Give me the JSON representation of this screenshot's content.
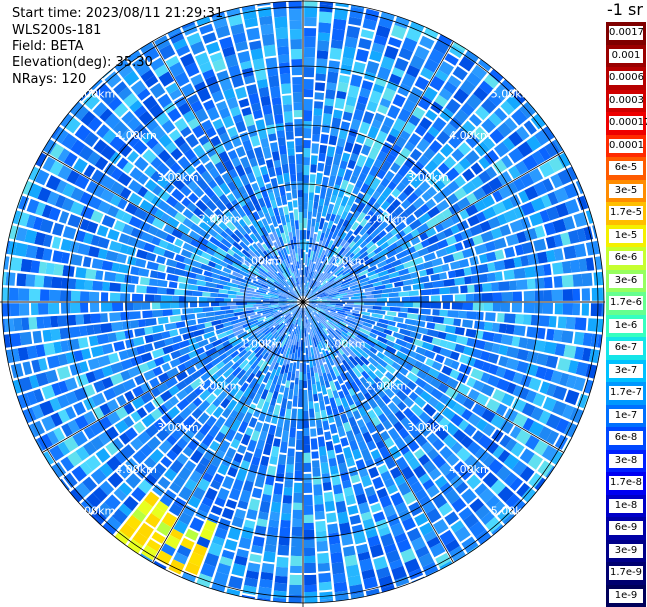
{
  "info": {
    "start_time": "Start time: 2023/08/11 21:29:31",
    "instrument": "WLS200s-181",
    "field": "Field: BETA",
    "elevation": "Elevation(deg): 35.30",
    "nrays": "NRays: 120"
  },
  "ppi": {
    "nrays": 120,
    "range_labels": [
      "1.00km",
      "2.00km",
      "3.00km",
      "4.00km",
      "5.00km"
    ]
  },
  "colorbar": {
    "title": "-1 sr",
    "entries": [
      {
        "label": "0.0017",
        "color": "#7f0000"
      },
      {
        "label": "0.001",
        "color": "#9a0000"
      },
      {
        "label": "0.0006",
        "color": "#b60000"
      },
      {
        "label": "0.0003",
        "color": "#d10000"
      },
      {
        "label": "0.00017",
        "color": "#ee0000"
      },
      {
        "label": "0.0001",
        "color": "#ff2a00"
      },
      {
        "label": "6e-5",
        "color": "#ff5a00"
      },
      {
        "label": "3e-5",
        "color": "#ff8c00"
      },
      {
        "label": "1.7e-5",
        "color": "#ffbe00"
      },
      {
        "label": "1e-5",
        "color": "#f4f000"
      },
      {
        "label": "6e-6",
        "color": "#c6ff2f"
      },
      {
        "label": "3e-6",
        "color": "#96ff5f"
      },
      {
        "label": "1.7e-6",
        "color": "#66ff8f"
      },
      {
        "label": "1e-6",
        "color": "#36ffc0"
      },
      {
        "label": "6e-7",
        "color": "#14e5e8"
      },
      {
        "label": "3e-7",
        "color": "#00c0ff"
      },
      {
        "label": "1.7e-7",
        "color": "#0098ff"
      },
      {
        "label": "1e-7",
        "color": "#0070ff"
      },
      {
        "label": "6e-8",
        "color": "#0048ff"
      },
      {
        "label": "3e-8",
        "color": "#0020ff"
      },
      {
        "label": "1.7e-8",
        "color": "#0000f2"
      },
      {
        "label": "1e-8",
        "color": "#0000c8"
      },
      {
        "label": "6e-9",
        "color": "#0000a6"
      },
      {
        "label": "3e-9",
        "color": "#000088"
      },
      {
        "label": "1.7e-9",
        "color": "#000070"
      },
      {
        "label": "1e-9",
        "color": "#00005a"
      }
    ]
  }
}
